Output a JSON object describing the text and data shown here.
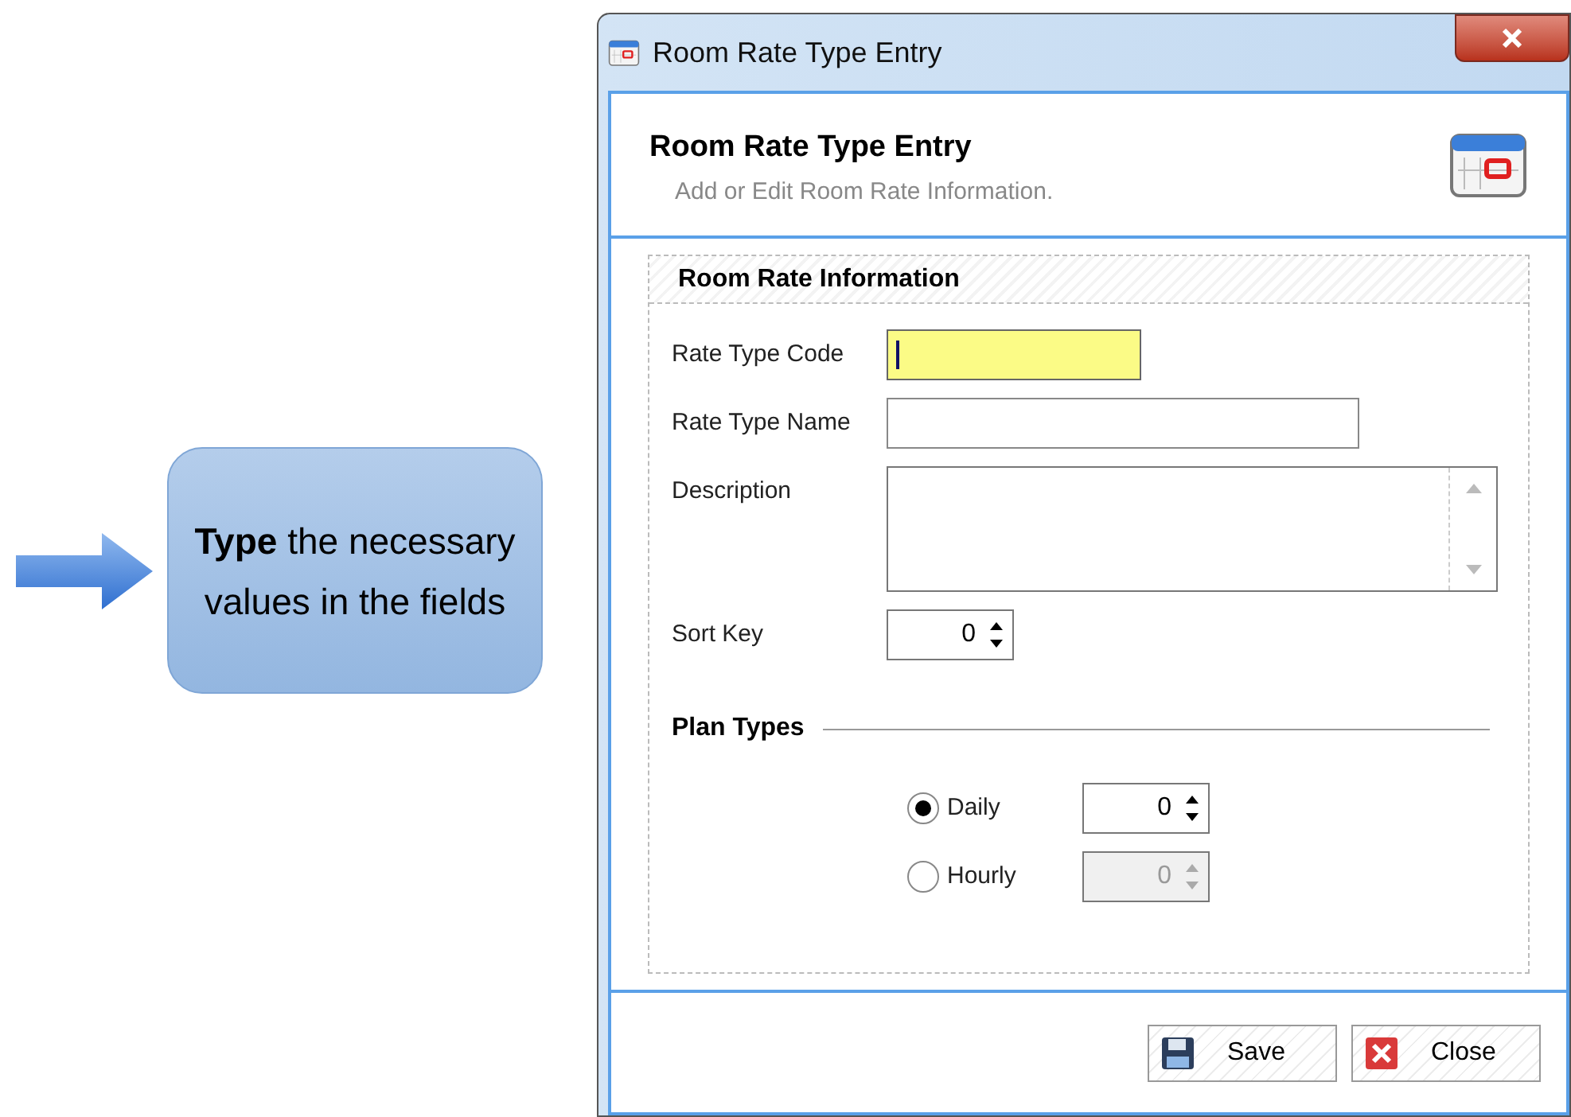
{
  "callout": {
    "text": "**Type** the necessary values in the fields"
  },
  "window": {
    "title": "Room Rate Type Entry"
  },
  "header": {
    "title": "Room Rate Type Entry",
    "subtitle": "Add or Edit Room Rate Information."
  },
  "group": {
    "title": "Room Rate Information",
    "fields": [
      {
        "kind": "text",
        "label": "Rate Type Code",
        "focused": true
      },
      {
        "kind": "text",
        "label": "Rate Type Name",
        "focused": false
      },
      {
        "kind": "memo",
        "label": "Description"
      },
      {
        "kind": "spin",
        "label": "Sort Key",
        "value": "0"
      }
    ]
  },
  "plan_types": {
    "title": "Plan Types",
    "options": [
      {
        "label": "Daily",
        "selected": true,
        "value": "0",
        "disabled": false
      },
      {
        "label": "Hourly",
        "selected": false,
        "value": "0",
        "disabled": true
      }
    ]
  },
  "buttons": [
    {
      "kind": "save",
      "label": "Save"
    },
    {
      "kind": "close",
      "label": "Close"
    }
  ]
}
